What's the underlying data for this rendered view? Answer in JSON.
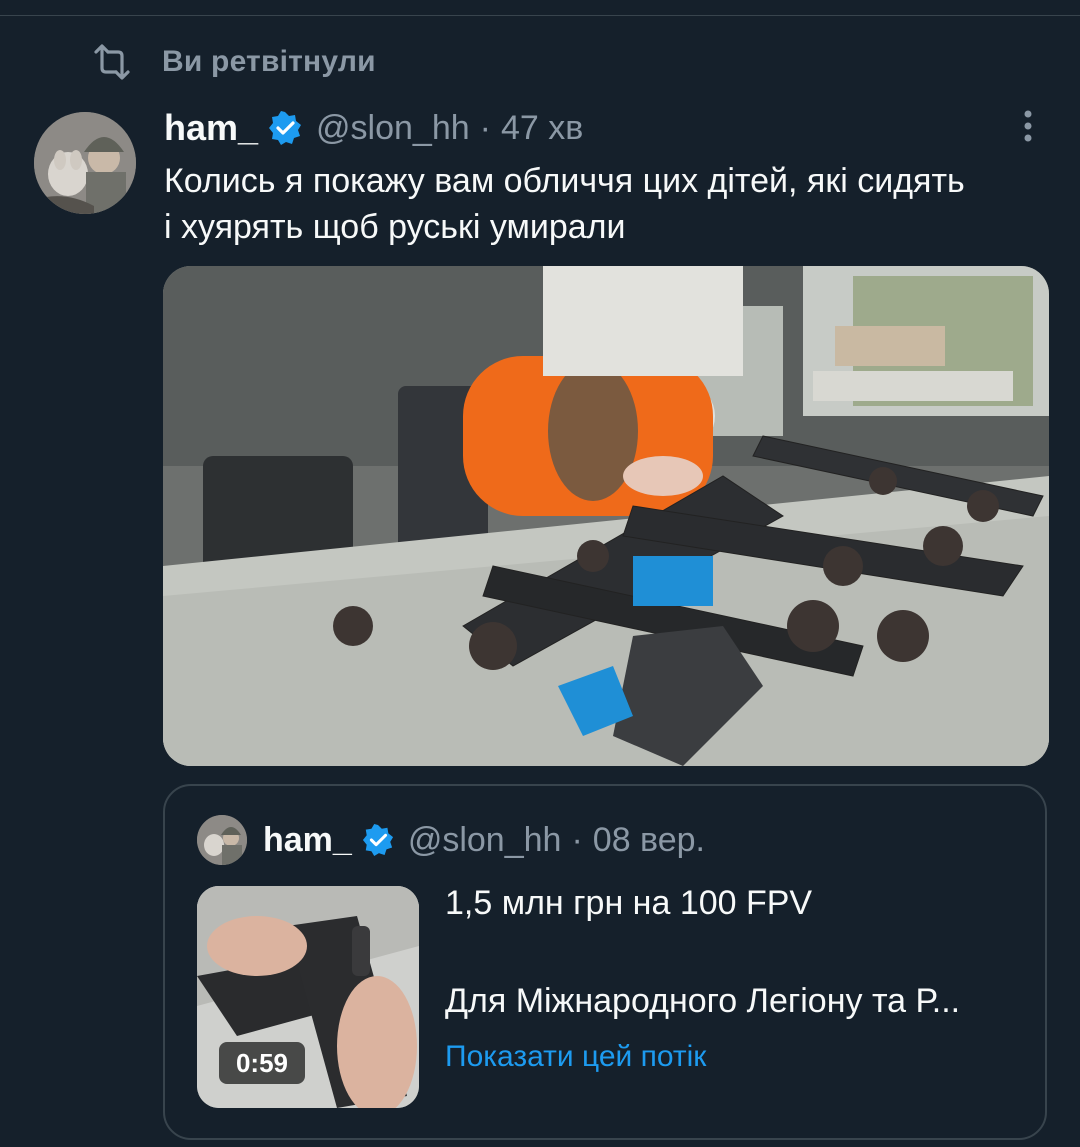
{
  "retweet": {
    "label": "Ви ретвітнули",
    "icon": "retweet-icon"
  },
  "tweet": {
    "author_name": "ham_",
    "handle": "@slon_hh",
    "separator": "·",
    "time": "47 хв",
    "text_line1": "Колись я покажу вам обличчя цих дітей, які сидять",
    "text_line2": "і хуярять щоб руські умирали",
    "verified_color": "#1d9bf0",
    "more_icon": "more-vertical-icon"
  },
  "quote": {
    "author_name": "ham_",
    "handle": "@slon_hh",
    "separator": "·",
    "time": "08 вер.",
    "text_line1": "1,5 млн грн на 100 FPV",
    "text_line2": "Для Міжнародного Легіону та Р...",
    "show_thread": "Показати цей потік",
    "video_duration": "0:59"
  },
  "colors": {
    "background": "#15202b",
    "secondary_text": "#8b98a5",
    "accent": "#1d9bf0",
    "border": "#38444d"
  }
}
